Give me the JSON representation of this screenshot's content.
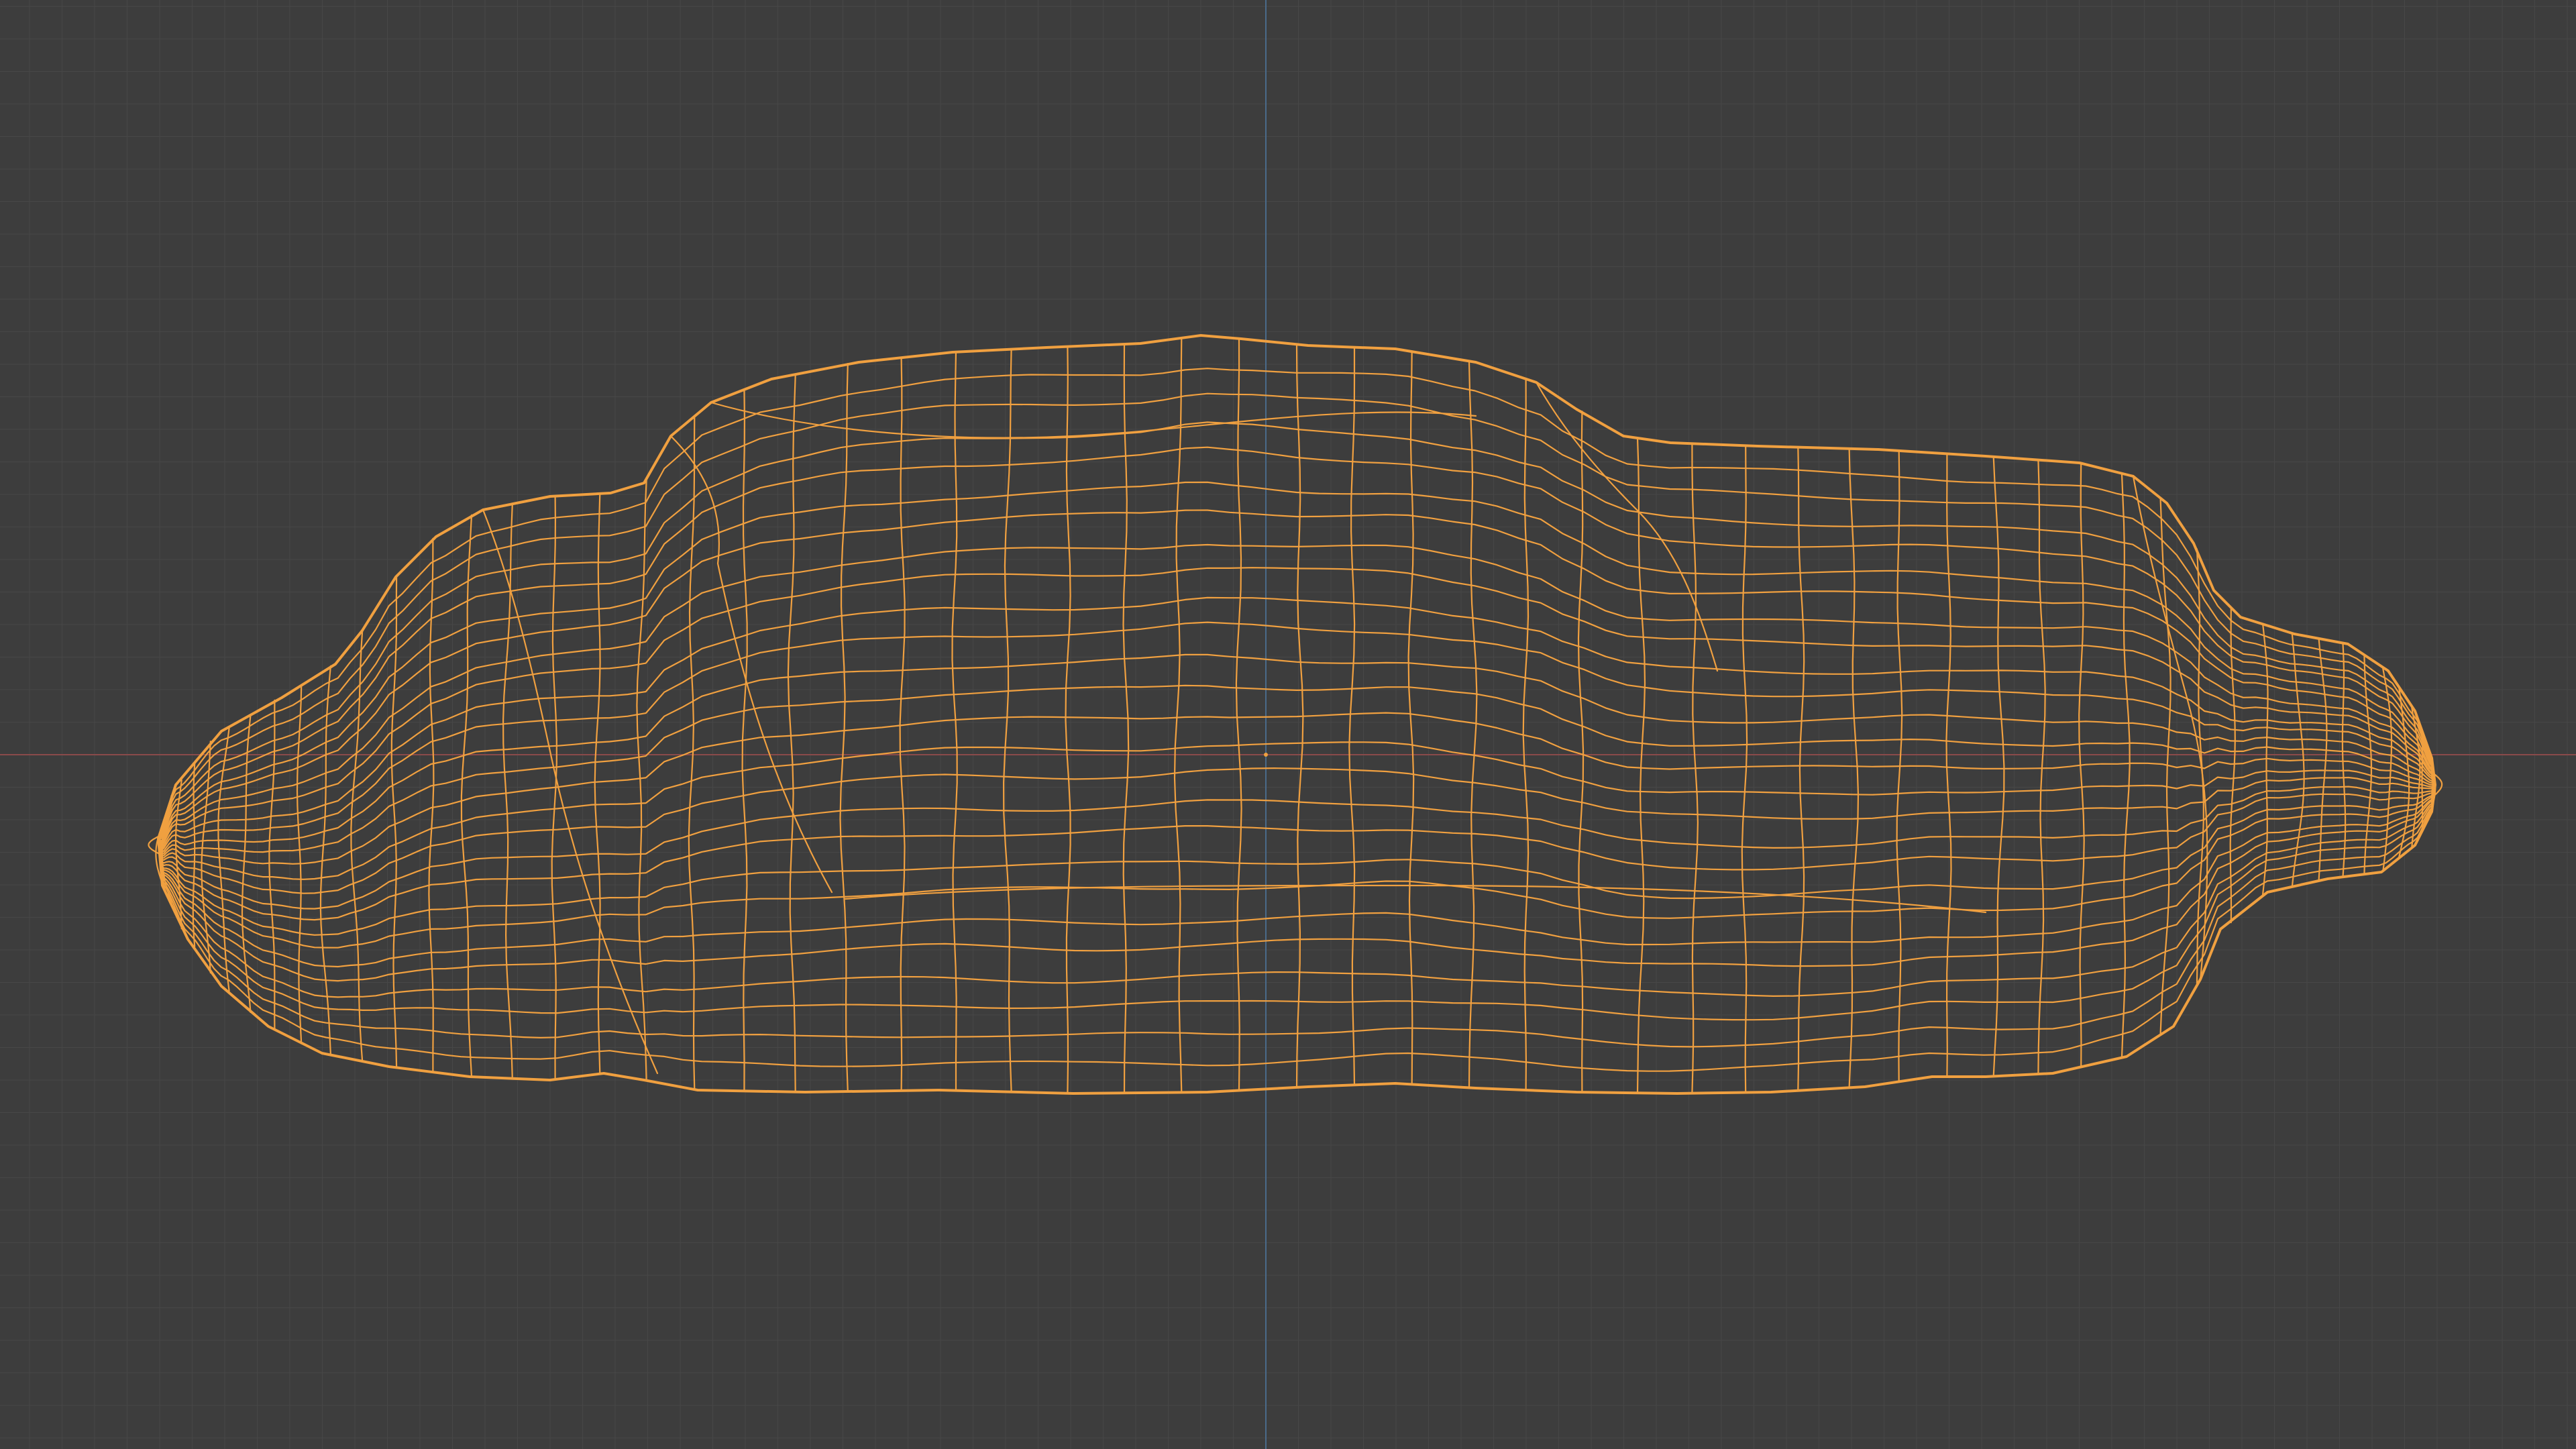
{
  "viewport": {
    "mode": "wireframe",
    "view": "orthographic-front",
    "background_color": "#3d3d3d",
    "grid_color": "#474747",
    "x_axis_color": "#8a4a4a",
    "z_axis_color": "#4a6a8a"
  },
  "object": {
    "selected": true,
    "wire_color": "#f0a040",
    "origin_color": "#f0a040"
  }
}
